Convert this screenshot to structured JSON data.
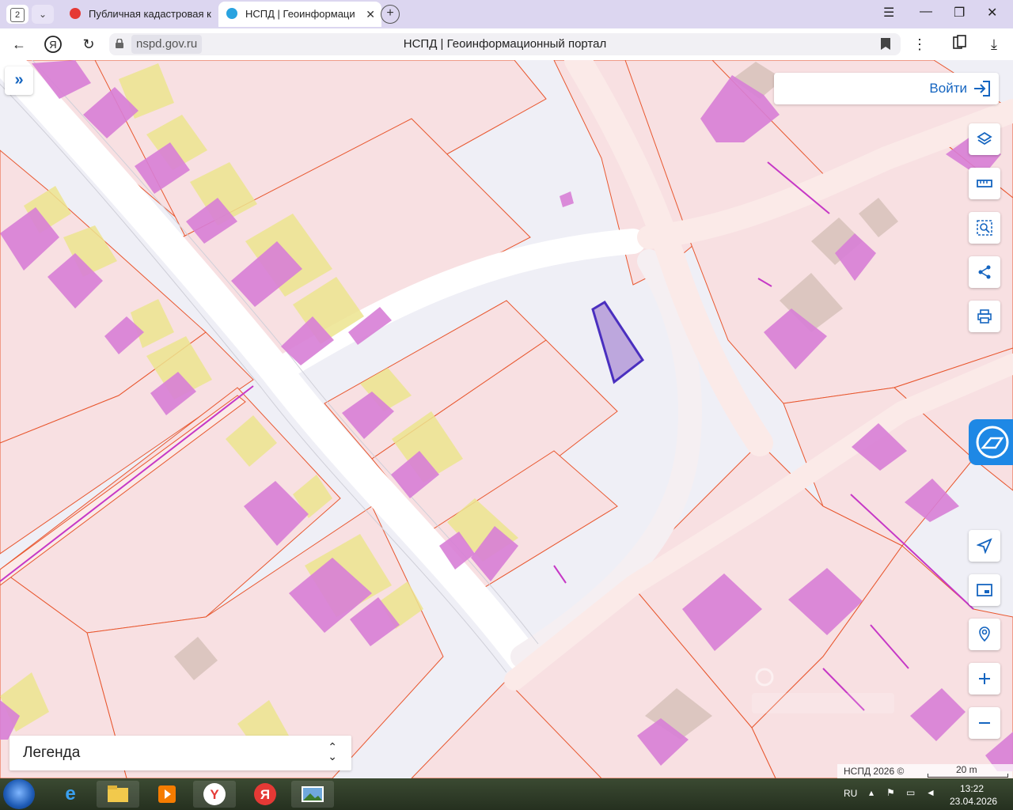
{
  "browser": {
    "tab_count": "2",
    "tabs": [
      {
        "label": "Публичная кадастровая к",
        "icon": "yandex-icon",
        "active": false
      },
      {
        "label": "НСПД | Геоинформаци",
        "icon": "nspd-icon",
        "active": true
      }
    ],
    "url_host": "nspd.gov.ru",
    "page_title": "НСПД | Геоинформационный портал"
  },
  "map": {
    "login_label": "Войти",
    "legend_label": "Легенда",
    "attribution": "НСПД 2026 ©",
    "scale_label": "20 m",
    "tools": [
      "layers-icon",
      "ruler-icon",
      "area-search-icon",
      "share-icon",
      "print-icon",
      "locate-icon",
      "minimap-icon",
      "geo-search-icon",
      "zoom-in-icon",
      "zoom-out-icon"
    ],
    "colors": {
      "parcel_fill": "#f8e0e2",
      "parcel_border": "#e8572f",
      "building_fill": "#d77ed6",
      "yellow_building": "#ece48e",
      "road": "#ffffff",
      "selected_fill": "#b49ad8",
      "selected_border": "#4a2fbf",
      "accent": "#1565c0"
    }
  },
  "taskbar": {
    "language": "RU",
    "time": "13:22",
    "date": "23.04.2026"
  }
}
